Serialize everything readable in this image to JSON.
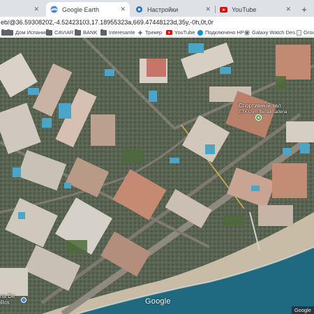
{
  "tabs": [
    {
      "label": "",
      "icon": "page-icon"
    },
    {
      "label": "Google Earth",
      "icon": "google-earth-icon",
      "active": true
    },
    {
      "label": "Настройки",
      "icon": "settings-gear-icon"
    },
    {
      "label": "YouTube",
      "icon": "youtube-icon"
    }
  ],
  "new_tab_label": "+",
  "address": {
    "url": "eb/@36.59308202,-4.52423103,17.18955323a,669.47448123d,35y,-0h,0t,0r"
  },
  "bookmarks": [
    {
      "label": "",
      "icon": "folder-icon"
    },
    {
      "label": "Дом Испания",
      "icon": "folder-icon"
    },
    {
      "label": "CAVIAR",
      "icon": "folder-icon"
    },
    {
      "label": "BANK",
      "icon": "folder-icon"
    },
    {
      "label": "Interesante",
      "icon": "folder-icon"
    },
    {
      "label": "Трекер",
      "icon": "tracker-icon"
    },
    {
      "label": "YouTube",
      "icon": "youtube-icon"
    },
    {
      "label": "Подключено HP",
      "icon": "hp-icon"
    },
    {
      "label": "Galaxy Watch Des...",
      "icon": "galaxy-watch-icon"
    },
    {
      "label": "Grou",
      "icon": "page-icon"
    }
  ],
  "map": {
    "poi_name": "Спортивный зал",
    "poi_subtitle": "ЕТК Gym Benalmadena",
    "poi_bottom_left_line1": "na De",
    "poi_bottom_left_line2": "illos",
    "watermark": "Google",
    "attribution": "Google"
  },
  "colors": {
    "tabstrip_bg": "#dee1e6",
    "youtube_red": "#ff0000",
    "poi_green": "#34a853",
    "sea": "#1f6a80",
    "beach": "#c9bca6"
  }
}
